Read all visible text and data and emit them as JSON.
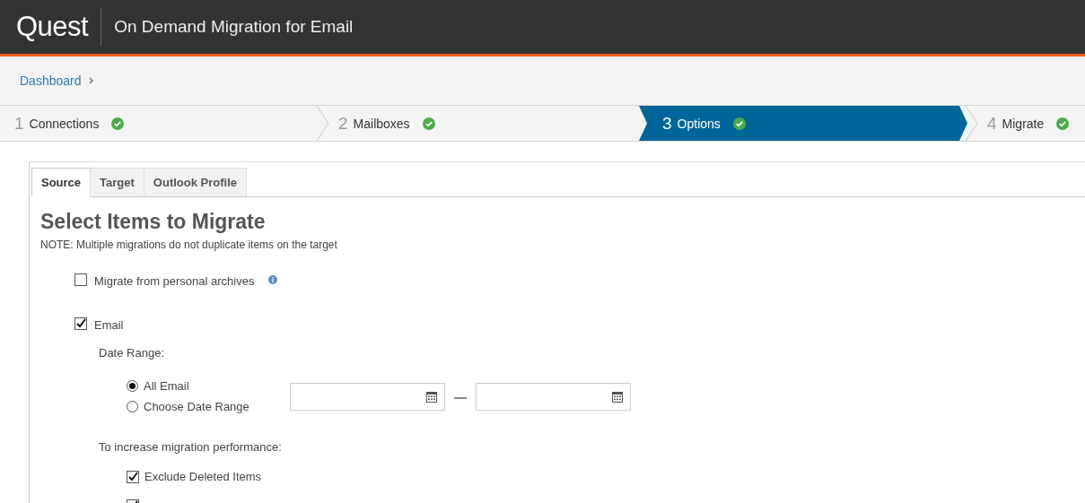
{
  "header": {
    "logo": "Quest",
    "title": "On Demand Migration for Email"
  },
  "breadcrumb": [
    {
      "label": "Dashboard"
    }
  ],
  "steps": [
    {
      "number": "1",
      "label": "Connections",
      "completed": true,
      "selected": false
    },
    {
      "number": "2",
      "label": "Mailboxes",
      "completed": true,
      "selected": false
    },
    {
      "number": "3",
      "label": "Options",
      "completed": true,
      "selected": true
    },
    {
      "number": "4",
      "label": "Migrate",
      "completed": true,
      "selected": false
    }
  ],
  "tabs": [
    {
      "label": "Source",
      "selected": true
    },
    {
      "label": "Target",
      "selected": false
    },
    {
      "label": "Outlook Profile",
      "selected": false
    }
  ],
  "heading": "Select Items to Migrate",
  "note": "NOTE: Multiple migrations do not duplicate items on the target",
  "archives": {
    "label": "Migrate from personal archives",
    "checked": false
  },
  "email": {
    "label": "Email",
    "checked": true
  },
  "date_range": {
    "label": "Date Range:",
    "options": [
      {
        "label": "All Email",
        "selected": true
      },
      {
        "label": "Choose Date Range",
        "selected": false
      }
    ]
  },
  "performance": {
    "label": "To increase migration performance:",
    "options": [
      {
        "label": "Exclude Deleted Items",
        "checked": true
      },
      {
        "checked": true
      }
    ]
  }
}
